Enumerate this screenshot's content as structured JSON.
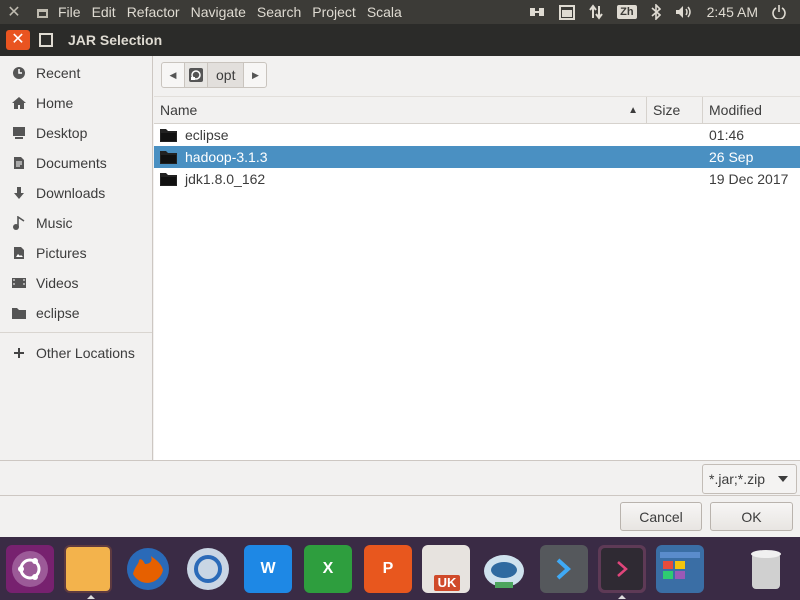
{
  "topbar": {
    "menu": [
      "File",
      "Edit",
      "Refactor",
      "Navigate",
      "Search",
      "Project",
      "Scala"
    ],
    "tray": {
      "keyboard_label": "Zh",
      "clock": "2:45 AM",
      "icons": [
        "network-icon",
        "calendar-icon",
        "transfer-icon",
        "bluetooth-icon",
        "volume-icon",
        "power-icon"
      ]
    }
  },
  "window": {
    "title": "JAR Selection"
  },
  "sidebar": {
    "items": [
      {
        "label": "Recent",
        "icon": "clock-icon"
      },
      {
        "label": "Home",
        "icon": "home-icon"
      },
      {
        "label": "Desktop",
        "icon": "desktop-icon"
      },
      {
        "label": "Documents",
        "icon": "document-icon"
      },
      {
        "label": "Downloads",
        "icon": "download-icon"
      },
      {
        "label": "Music",
        "icon": "music-icon"
      },
      {
        "label": "Pictures",
        "icon": "pictures-icon"
      },
      {
        "label": "Videos",
        "icon": "videos-icon"
      },
      {
        "label": "eclipse",
        "icon": "folder-icon"
      }
    ],
    "other_locations": "Other Locations"
  },
  "pathbar": {
    "current": "opt"
  },
  "filelist": {
    "columns": {
      "name": "Name",
      "size": "Size",
      "modified": "Modified"
    },
    "rows": [
      {
        "name": "eclipse",
        "size": "",
        "modified": "01:46",
        "selected": false
      },
      {
        "name": "hadoop-3.1.3",
        "size": "",
        "modified": "26 Sep",
        "selected": true
      },
      {
        "name": "jdk1.8.0_162",
        "size": "",
        "modified": "19 Dec 2017",
        "selected": false
      }
    ]
  },
  "filter": {
    "value": "*.jar;*.zip"
  },
  "buttons": {
    "cancel": "Cancel",
    "ok": "OK"
  },
  "dock": {
    "apps": [
      {
        "name": "ubuntu-icon",
        "color": "#77216f",
        "badge": ""
      },
      {
        "name": "files-icon",
        "color": "#f3b34c",
        "badge": ""
      },
      {
        "name": "firefox-icon",
        "color": "#e66000",
        "badge": ""
      },
      {
        "name": "browser-icon",
        "color": "#4a8fd4",
        "badge": ""
      },
      {
        "name": "word-icon",
        "color": "#1e88e5",
        "badge": "W"
      },
      {
        "name": "excel-icon",
        "color": "#2e9e3e",
        "badge": "X"
      },
      {
        "name": "powerpoint-icon",
        "color": "#e8571e",
        "badge": "P"
      },
      {
        "name": "software-center-icon",
        "color": "#e7e3df",
        "badge": "UK"
      },
      {
        "name": "robot-icon",
        "color": "#9fc4d8",
        "badge": ""
      },
      {
        "name": "vscode-icon",
        "color": "#55585c",
        "badge": ">"
      },
      {
        "name": "terminal-icon",
        "color": "#2f2a33",
        "badge": ">"
      },
      {
        "name": "desktop-window-icon",
        "color": "#3a6ea5",
        "badge": ""
      },
      {
        "name": "trash-icon",
        "color": "#d0d0d0",
        "badge": ""
      }
    ]
  }
}
